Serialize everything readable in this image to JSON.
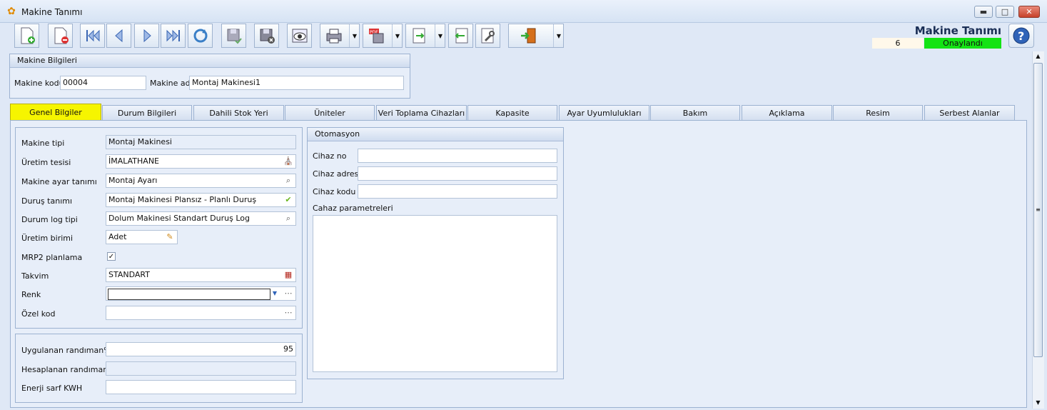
{
  "window": {
    "title": "Makine Tanımı"
  },
  "header": {
    "form_title": "Makine Tanımı",
    "count": "6",
    "status": "Onaylandı",
    "status_color": "#14e314"
  },
  "toolbar": {
    "buttons": [
      "new",
      "delete",
      "first",
      "previous",
      "next",
      "last",
      "refresh",
      "save",
      "cancel",
      "preview",
      "print",
      "pdf",
      "export",
      "import",
      "tools",
      "exit"
    ]
  },
  "machine_info": {
    "title": "Makine Bilgileri",
    "code_label": "Makine kodu",
    "code_value": "00004",
    "name_label": "Makine adı",
    "name_value": "Montaj Makinesi1"
  },
  "tabs": [
    "Genel Bilgiler",
    "Durum Bilgileri",
    "Dahili Stok Yeri",
    "Üniteler",
    "Veri Toplama Cihazları",
    "Kapasite",
    "Ayar Uyumlulukları",
    "Bakım",
    "Açıklama",
    "Resim",
    "Serbest Alanlar"
  ],
  "general": {
    "fields": [
      {
        "label": "Makine tipi",
        "value": "Montaj Makinesi"
      },
      {
        "label": "Üretim tesisi",
        "value": "İMALATHANE"
      },
      {
        "label": "Makine ayar tanımı",
        "value": "Montaj Ayarı"
      },
      {
        "label": "Duruş tanımı",
        "value": "Montaj Makinesi Plansız - Planlı Duruş"
      },
      {
        "label": "Durum log tipi",
        "value": "Dolum Makinesi Standart Duruş Log"
      },
      {
        "label": "Üretim birimi",
        "value": "Adet"
      },
      {
        "label": "MRP2 planlama",
        "value": ""
      },
      {
        "label": "Takvim",
        "value": "STANDART"
      },
      {
        "label": "Renk",
        "value": ""
      },
      {
        "label": "Özel kod",
        "value": ""
      }
    ],
    "mrp2_checked": true
  },
  "efficiency": {
    "applied_label": "Uygulanan randıman%",
    "applied_value": "95",
    "calculated_label": "Hesaplanan randıman%",
    "calculated_value": "",
    "energy_label": "Enerji sarf KWH",
    "energy_value": ""
  },
  "automation": {
    "title": "Otomasyon",
    "device_no_label": "Cihaz no",
    "device_address_label": "Cihaz adresi",
    "device_code_label": "Cihaz kodu",
    "params_label": "Cahaz parametreleri"
  }
}
